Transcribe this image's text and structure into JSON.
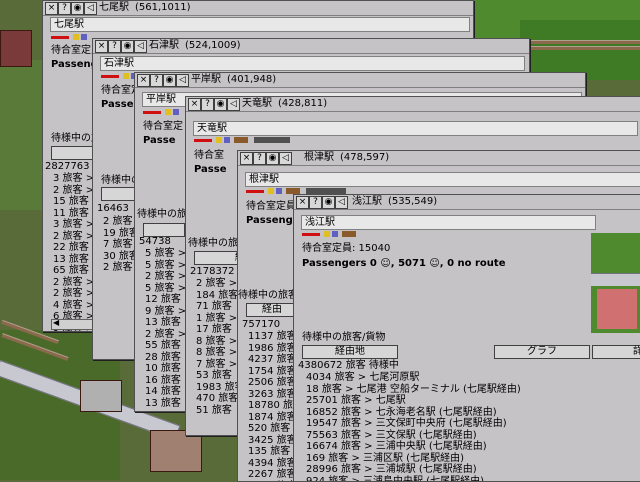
{
  "windows": [
    {
      "title": "七尾駅",
      "coords": "(561,1011)",
      "name": "七尾駅",
      "capacity": "待合室定員: ",
      "passengers": "Passeng",
      "section_label": "待様中の旅",
      "btn_route": "経",
      "total": "2827763",
      "rows": [
        "3 旅客 >",
        "2 旅客 >",
        "15 旅客",
        "11 旅客",
        "3 旅客 >",
        "2 旅客 >",
        "22 旅客",
        "13 旅客",
        "65 旅客",
        "2 旅客 >",
        "2 旅客 >",
        "4 旅客 >",
        "6 旅客 >",
        "9 旅客 >"
      ],
      "scroll_label": ""
    },
    {
      "title": "石津駅",
      "coords": "(524,1009)",
      "name": "石津駅",
      "capacity": "待合室定",
      "passengers": "Passe",
      "section_label": "待様中の旅",
      "btn_route": "",
      "total": "16463",
      "rows": [
        "2 旅客",
        "19 旅客",
        "7 旅客",
        "30 旅客",
        "2 旅客"
      ],
      "scroll_label": "",
      "extra_label": "浅江"
    },
    {
      "title": "平岸駅",
      "coords": "(401,948)",
      "name": "平岸駅",
      "capacity": "待合室定",
      "passengers": "Passe",
      "section_label": "待様中の旅",
      "btn_route": "",
      "total": "54738",
      "rows": [
        "5 旅客 >",
        "5 旅客 >",
        "2 旅客 >",
        "5 旅客 >",
        "12 旅客",
        "9 旅客 >",
        "13 旅客",
        "2 旅客 >",
        "55 旅客",
        "28 旅客",
        "10 旅客",
        "16 旅客",
        "14 旅客",
        "13 旅客"
      ],
      "scroll_label": ""
    },
    {
      "title": "天竜駅",
      "coords": "(428,811)",
      "name": "天竜駅",
      "capacity": "待合室",
      "passengers": "Passe",
      "section_label": "待様中の旅",
      "btn_route": "経",
      "total": "2178372",
      "rows": [
        "2 旅客 >",
        "184 旅客",
        "71 旅客",
        "1 旅客 >",
        "17 旅客",
        "8 旅客 >",
        "8 旅客 >",
        "7 旅客 >",
        "53 旅客",
        "1983 旅客",
        "470 旅客",
        "51 旅客"
      ],
      "scroll_label": ""
    },
    {
      "title": "根津駅",
      "coords": "(478,597)",
      "name": "根津駅",
      "capacity": "待合室定員:",
      "passengers": "Passeng",
      "section_label": "待様中の旅客",
      "btn_route": "経由",
      "total": "757170",
      "rows": [
        "1137 旅客",
        "1986 旅客",
        "4237 旅客",
        "1754 旅客",
        "2506 旅客",
        "3263 旅客",
        "18780 旅客",
        "1874 旅客",
        "520 旅客",
        "3425 旅客",
        "135 旅客",
        "4394 旅客",
        "2267 旅客",
        "3908 旅客"
      ],
      "scroll_label": ""
    },
    {
      "title": "浅江駅",
      "coords": "(535,549)",
      "name": "浅江駅",
      "capacity": "待合室定員: 15040",
      "passengers": "Passengers 0 ☺, 5071 ☺, 0 no route",
      "section_label": "待様中の旅客/貨物",
      "btn_route": "経由地",
      "btn_graph": "グラフ",
      "btn_detail": "詳細",
      "total": "4380672 旅客  待様中",
      "rows": [
        "4034 旅客 > 七尾河原駅",
        "18 旅客 > 七尾港 空船ターミナル (七尾駅経由)",
        "25701 旅客 > 七尾駅",
        "16852 旅客 > 七永海老名駅 (七尾駅経由)",
        "19547 旅客 > 三文保町中央府 (七尾駅経由)",
        "75563 旅客 > 三文保駅 (七尾駅経由)",
        "16674 旅客 > 三浦中央駅 (七尾駅経由)",
        "169 旅客 > 三浦区駅 (七尾駅経由)",
        "28996 旅客 > 三浦城駅 (七尾駅経由)",
        "924 旅客 > 三浦島中央駅 (七尾駅経由)"
      ],
      "rows_partial_prefix": ""
    }
  ],
  "colors": {
    "window_bg": "#c6c3c6",
    "route_bar": "#d01010"
  }
}
